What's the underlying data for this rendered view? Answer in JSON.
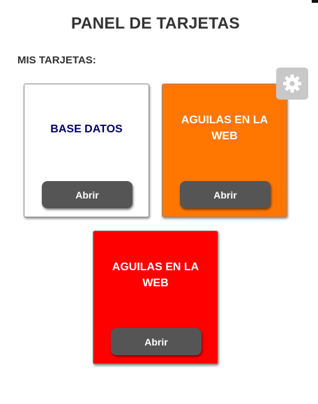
{
  "header": {
    "title": "PANEL DE TARJETAS"
  },
  "section": {
    "label": "MIS TARJETAS:"
  },
  "settings": {
    "icon": "gear-icon",
    "background": "#c8c8c8"
  },
  "cards": [
    {
      "title": "BASE DATOS",
      "button_label": "Abrir",
      "background": "#ffffff",
      "title_color": "#000066"
    },
    {
      "title": "AGUILAS EN LA WEB",
      "button_label": "Abrir",
      "background": "#ff7700",
      "title_color": "#ffffff"
    },
    {
      "title": "AGUILAS EN LA WEB",
      "button_label": "Abrir",
      "background": "#ff0000",
      "title_color": "#ffffff"
    }
  ],
  "colors": {
    "button": "#555555",
    "text": "#333333"
  }
}
